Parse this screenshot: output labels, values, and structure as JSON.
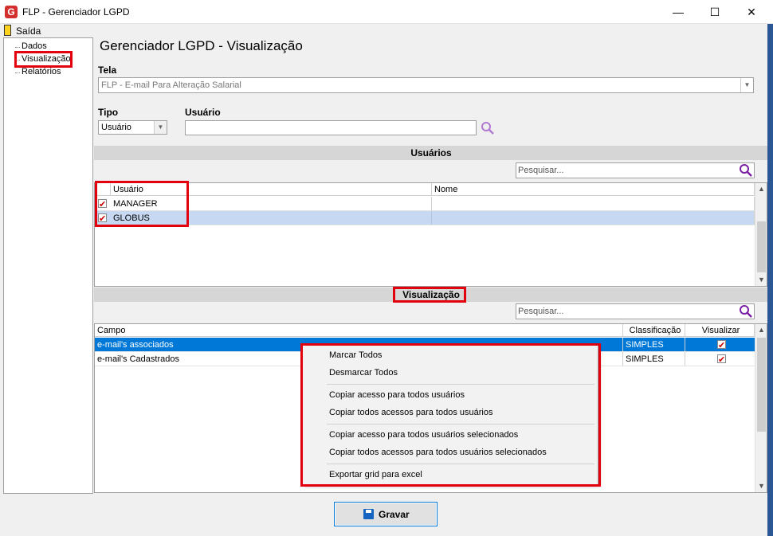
{
  "window": {
    "title": "FLP - Gerenciador LGPD",
    "logo_letter": "G",
    "minimize": "—",
    "maximize": "☐",
    "close": "✕"
  },
  "menu": {
    "exit": "Saída"
  },
  "tree": {
    "items": [
      "Dados",
      "Visualização",
      "Relatórios"
    ],
    "selected": "Visualização"
  },
  "page": {
    "title": "Gerenciador LGPD - Visualização"
  },
  "tela": {
    "label": "Tela",
    "value": "FLP - E-mail Para Alteração Salarial"
  },
  "tipo": {
    "label": "Tipo",
    "value": "Usuário"
  },
  "usuario": {
    "label": "Usuário",
    "value": ""
  },
  "users_section": {
    "title": "Usuários",
    "search_placeholder": "Pesquisar...",
    "columns": [
      "Usuário",
      "Nome"
    ],
    "rows": [
      {
        "user": "MANAGER",
        "name": "",
        "checked": true
      },
      {
        "user": "GLOBUS",
        "name": "",
        "checked": true
      }
    ]
  },
  "view_section": {
    "title": "Visualização",
    "search_placeholder": "Pesquisar...",
    "columns": [
      "Campo",
      "Classificação",
      "Visualizar"
    ],
    "rows": [
      {
        "field": "e-mail's associados",
        "classification": "SIMPLES",
        "view": true
      },
      {
        "field": "e-mail's Cadastrados",
        "classification": "SIMPLES",
        "view": true
      }
    ]
  },
  "context_menu": {
    "items": [
      "Marcar Todos",
      "Desmarcar Todos",
      "Copiar acesso para todos usuários",
      "Copiar todos acessos para todos usuários",
      "Copiar acesso para todos usuários selecionados",
      "Copiar todos acessos para todos usuários selecionados",
      "Exportar grid para excel"
    ]
  },
  "save_button": {
    "label": "Gravar"
  },
  "colors": {
    "highlight": "#e3000f",
    "selection": "#0078d7",
    "search_icon": "#7b1fa2"
  }
}
